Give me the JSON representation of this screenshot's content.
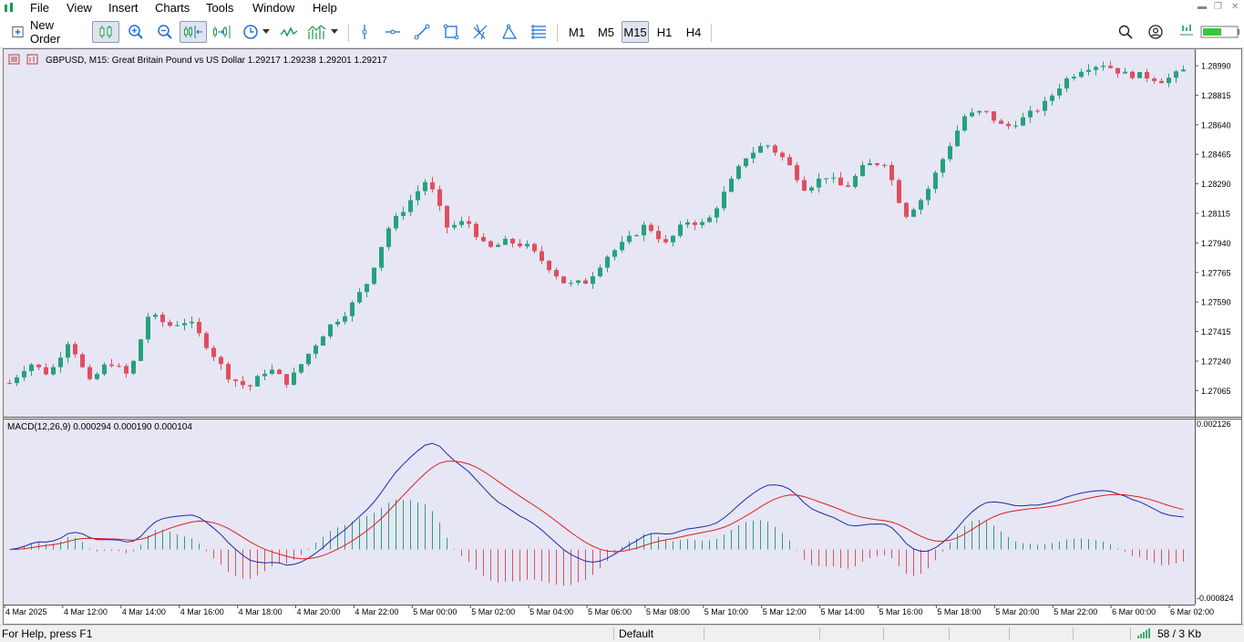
{
  "menu": {
    "items": [
      "File",
      "View",
      "Insert",
      "Charts",
      "Tools",
      "Window",
      "Help"
    ]
  },
  "toolbar": {
    "new_order_label": "New Order",
    "timeframes": [
      "M1",
      "M5",
      "M15",
      "H1",
      "H4"
    ],
    "active_timeframe": "M15"
  },
  "chart": {
    "symbol_label": "GBPUSD, M15:  Great Britain Pound vs US Dollar  1.29217 1.29238 1.29201 1.29217",
    "indicator_label": "MACD(12,26,9) 0.000294 0.000190 0.000104",
    "price_ticks": [
      "1.28990",
      "1.28815",
      "1.28640",
      "1.28465",
      "1.28290",
      "1.28115",
      "1.27940",
      "1.27765",
      "1.27590",
      "1.27415",
      "1.27240",
      "1.27065"
    ],
    "macd_ticks": [
      "0.002126",
      "-0.000824"
    ],
    "time_ticks": [
      "4 Mar 2025",
      "4 Mar 12:00",
      "4 Mar 14:00",
      "4 Mar 16:00",
      "4 Mar 18:00",
      "4 Mar 20:00",
      "4 Mar 22:00",
      "5 Mar 00:00",
      "5 Mar 02:00",
      "5 Mar 04:00",
      "5 Mar 06:00",
      "5 Mar 08:00",
      "5 Mar 10:00",
      "5 Mar 12:00",
      "5 Mar 14:00",
      "5 Mar 16:00",
      "5 Mar 18:00",
      "5 Mar 20:00",
      "5 Mar 22:00",
      "6 Mar 00:00",
      "6 Mar 02:00"
    ],
    "colors": {
      "background": "#e6e6f5",
      "bull": "#26a17b",
      "bear": "#e04e5e",
      "macd_line": "#1e2aa8",
      "signal_line": "#e01e1e"
    },
    "price_path": [
      1.2711,
      1.2723,
      1.2716,
      1.2737,
      1.2711,
      1.2724,
      1.2715,
      1.2752,
      1.2745,
      1.2748,
      1.2732,
      1.2715,
      1.2708,
      1.272,
      1.2711,
      1.2728,
      1.2744,
      1.2754,
      1.2771,
      1.2802,
      1.2817,
      1.2832,
      1.2803,
      1.2807,
      1.279,
      1.2795,
      1.2792,
      1.2781,
      1.2769,
      1.2771,
      1.2786,
      1.2795,
      1.2805,
      1.2793,
      1.2807,
      1.2805,
      1.2825,
      1.2845,
      1.2853,
      1.2843,
      1.2826,
      1.2834,
      1.2826,
      1.284,
      1.2842,
      1.281,
      1.2822,
      1.2846,
      1.2869,
      1.2872,
      1.2862,
      1.2868,
      1.2876,
      1.289,
      1.2898,
      1.29,
      1.2894,
      1.2893,
      1.289,
      1.2896
    ]
  },
  "status": {
    "help_text": "For Help, press F1",
    "profile": "Default",
    "traffic": "58 / 3 Kb"
  }
}
